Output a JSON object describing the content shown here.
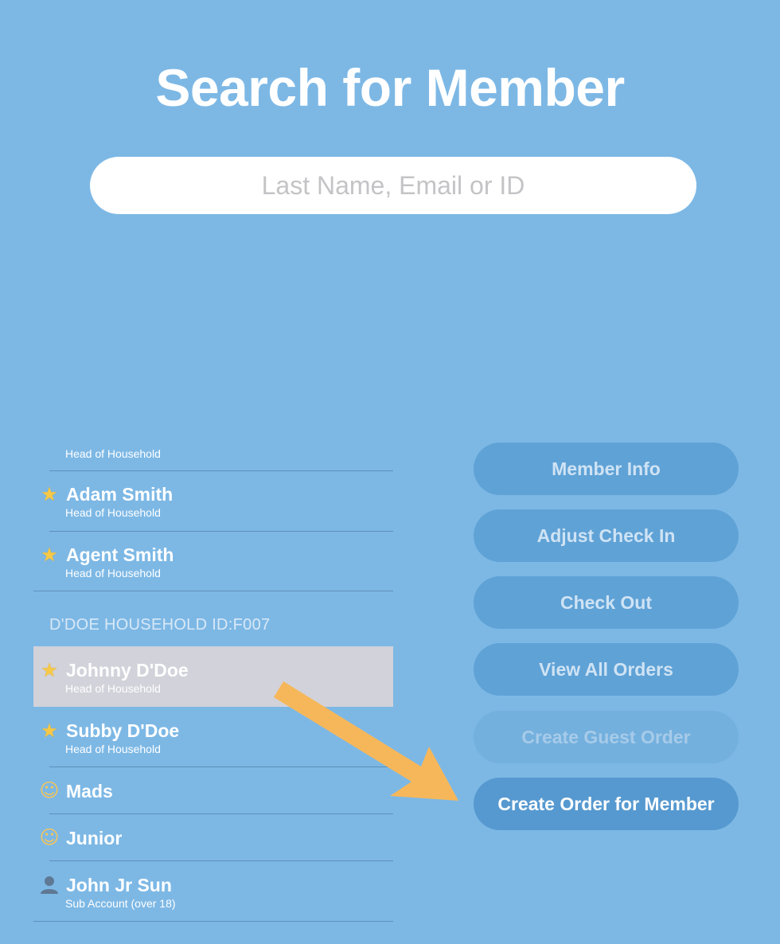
{
  "header": {
    "title": "Search for Member"
  },
  "search": {
    "placeholder": "Last Name, Email or ID",
    "value": ""
  },
  "members": {
    "row0": {
      "sub": "Head of Household"
    },
    "row1": {
      "name": "Adam Smith",
      "sub": "Head of Household",
      "icon": "star-icon"
    },
    "row2": {
      "name": "Agent Smith",
      "sub": "Head of Household",
      "icon": "star-icon"
    },
    "section_header": "D'DOE HOUSEHOLD ID:F007",
    "row3": {
      "name": "Johnny D'Doe",
      "sub": "Head of Household",
      "icon": "star-icon",
      "selected": true
    },
    "row4": {
      "name": "Subby D'Doe",
      "sub": "Head of Household",
      "icon": "star-icon"
    },
    "row5": {
      "name": "Mads",
      "icon": "baby-icon"
    },
    "row6": {
      "name": "Junior",
      "icon": "baby-icon"
    },
    "row7": {
      "name": "John Jr Sun",
      "sub": "Sub Account (over 18)",
      "icon": "person-icon"
    }
  },
  "actions": {
    "member_info": "Member Info",
    "adjust_check_in": "Adjust Check In",
    "check_out": "Check Out",
    "view_all_orders": "View All Orders",
    "create_guest_order": "Create Guest Order",
    "create_order_for_member": "Create Order for Member"
  },
  "colors": {
    "background": "#7db8e5",
    "button": "#5fa2d6",
    "button_primary": "#5699d0",
    "selected_row": "#d2d2da",
    "arrow": "#f6b75a"
  }
}
